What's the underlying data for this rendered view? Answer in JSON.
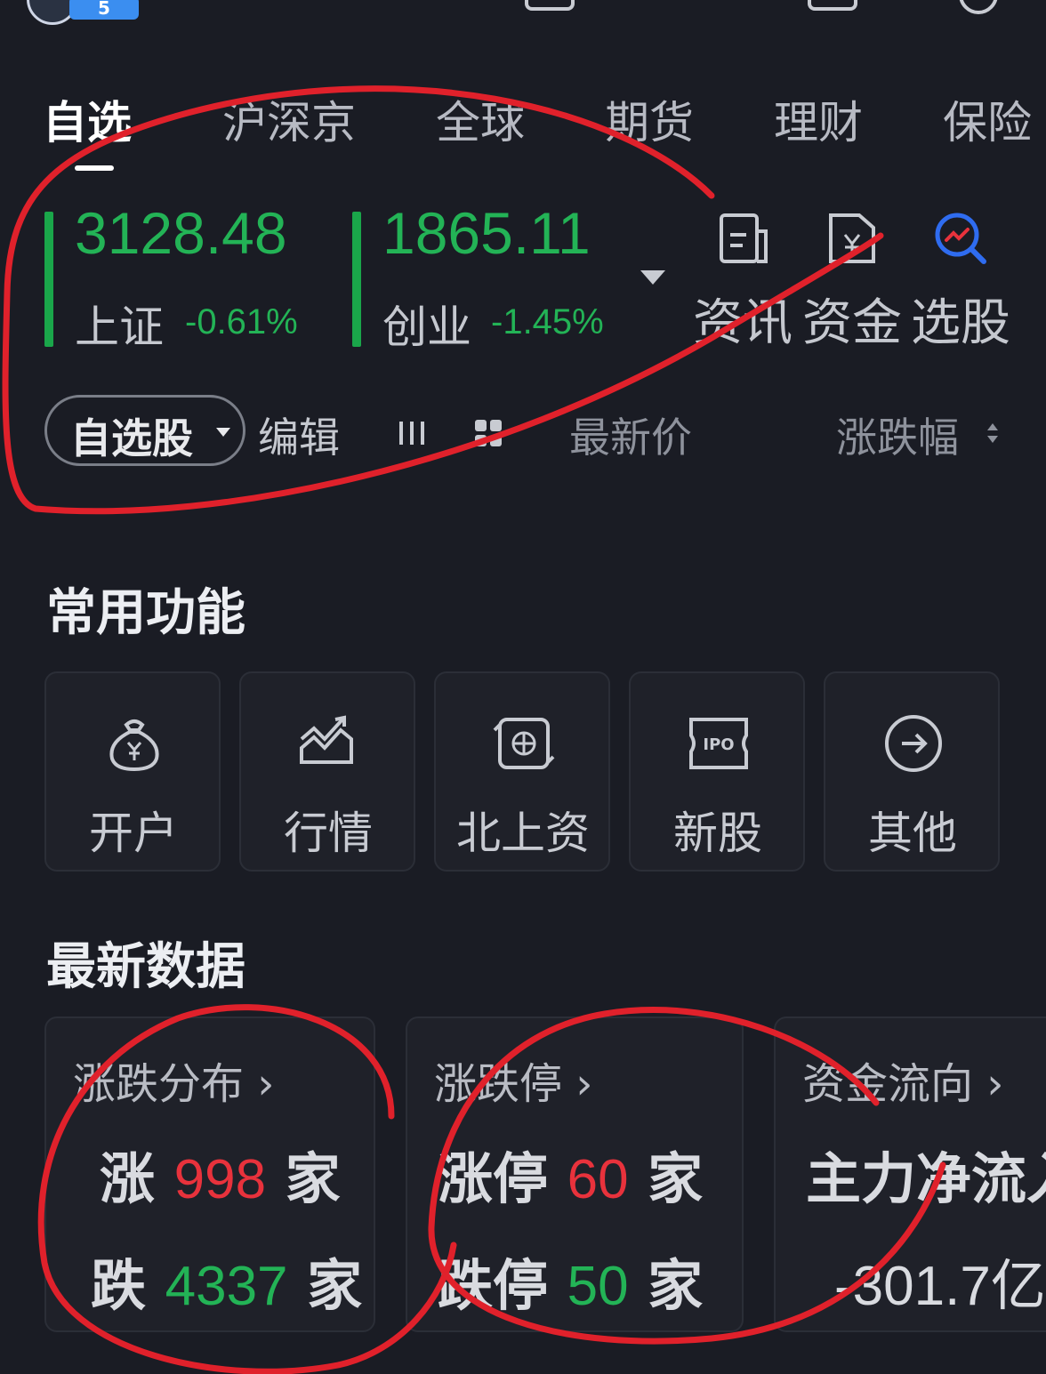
{
  "top": {
    "level_badge": "5"
  },
  "tabs": [
    {
      "label": "自选",
      "active": true
    },
    {
      "label": "沪深京",
      "active": false
    },
    {
      "label": "全球",
      "active": false
    },
    {
      "label": "期货",
      "active": false
    },
    {
      "label": "理财",
      "active": false
    },
    {
      "label": "保险",
      "active": false
    }
  ],
  "indices": [
    {
      "value": "3128.48",
      "name": "上证",
      "change": "-0.61%"
    },
    {
      "value": "1865.11",
      "name": "创业",
      "change": "-1.45%"
    }
  ],
  "quick_links": [
    {
      "label": "资讯",
      "icon": "news-doc-icon"
    },
    {
      "label": "资金",
      "icon": "yuan-doc-icon"
    },
    {
      "label": "选股",
      "icon": "stock-search-icon"
    }
  ],
  "toolbar": {
    "watchlist_label": "自选股",
    "edit_label": "编辑",
    "latest_price_label": "最新价",
    "change_pct_label": "涨跌幅"
  },
  "functions": {
    "title": "常用功能",
    "items": [
      {
        "label": "开户",
        "icon": "money-bag-icon"
      },
      {
        "label": "行情",
        "icon": "trend-chart-icon"
      },
      {
        "label": "北上资",
        "icon": "hk-flower-icon"
      },
      {
        "label": "新股",
        "icon": "ipo-ticket-icon"
      },
      {
        "label": "其他",
        "icon": "arrow-circle-icon"
      }
    ]
  },
  "latest_data": {
    "title": "最新数据",
    "distribution": {
      "title": "涨跌分布",
      "up_prefix": "涨",
      "up_count": "998",
      "up_suffix": "家",
      "down_prefix": "跌",
      "down_count": "4337",
      "down_suffix": "家"
    },
    "limit": {
      "title": "涨跌停",
      "up_prefix": "涨停",
      "up_count": "60",
      "up_suffix": "家",
      "down_prefix": "跌停",
      "down_count": "50",
      "down_suffix": "家"
    },
    "fund_flow": {
      "title": "资金流向",
      "label": "主力净流入",
      "value": "-301.7亿"
    }
  },
  "colors": {
    "up": "#e8323c",
    "down": "#23b356",
    "background": "#1a1c24",
    "annotation": "#e0212b"
  }
}
